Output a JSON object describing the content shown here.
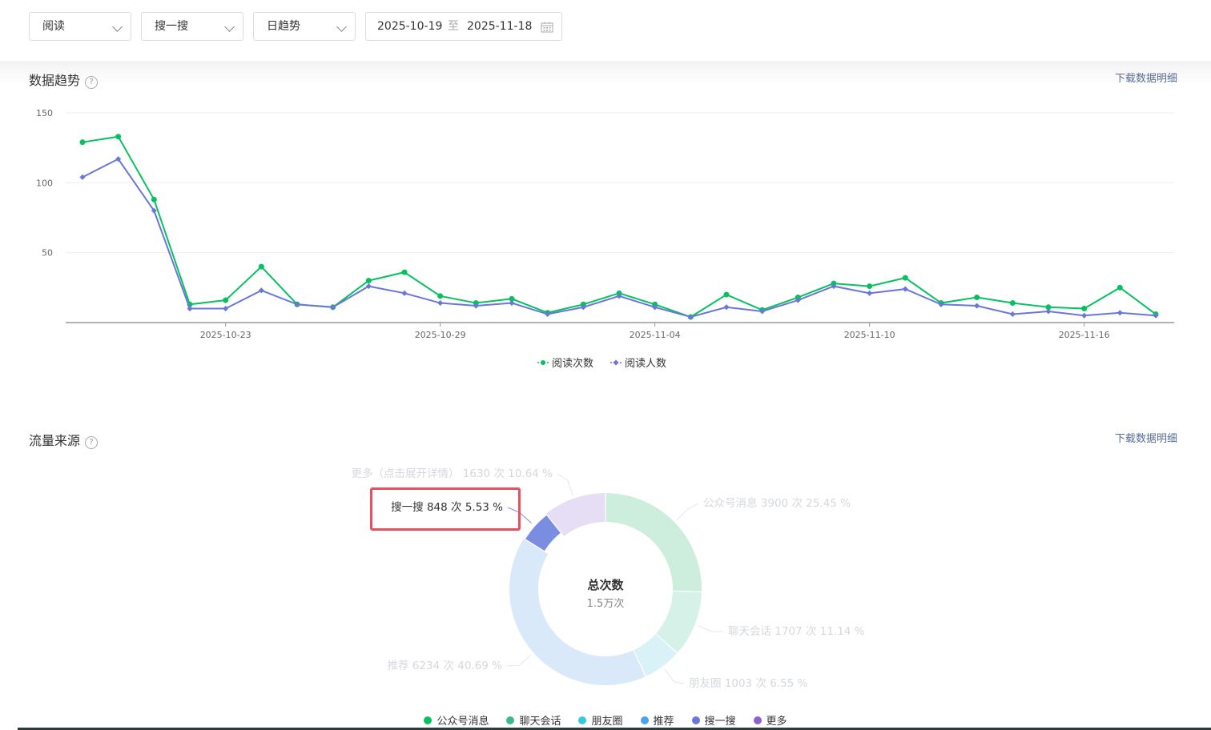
{
  "filters": {
    "metric": "阅读",
    "source": "搜一搜",
    "granularity": "日趋势",
    "date_start": "2025-10-19",
    "date_sep": "至",
    "date_end": "2025-11-18"
  },
  "trend": {
    "title": "数据趋势",
    "help": "?",
    "download": "下载数据明细"
  },
  "source_section": {
    "title": "流量来源",
    "help": "?",
    "download": "下载数据明细",
    "center_title": "总次数",
    "center_value": "1.5万次",
    "slices": [
      {
        "name": "公众号消息",
        "label": "公众号消息 3900 次 25.45 %",
        "value": 3900,
        "color": "#cdeedd"
      },
      {
        "name": "聊天会话",
        "label": "聊天会话 1707 次 11.14 %",
        "value": 1707,
        "color": "#d6f1e8"
      },
      {
        "name": "朋友圈",
        "label": "朋友圈 1003 次 6.55 %",
        "value": 1003,
        "color": "#d9f2f8"
      },
      {
        "name": "推荐",
        "label": "推荐 6234 次 40.69 %",
        "value": 6234,
        "color": "#d9e9f9"
      },
      {
        "name": "搜一搜",
        "label": "搜一搜 848 次 5.53 %",
        "value": 848,
        "color": "#7b8de0"
      },
      {
        "name": "更多",
        "label": "更多（点击展开详情） 1630 次 10.64 %",
        "value": 1630,
        "color": "#e6def4"
      }
    ],
    "legend_colors": [
      "#07c160",
      "#3cb98c",
      "#35c9e0",
      "#4aa3ef",
      "#6a77d8",
      "#8d5fd3"
    ]
  },
  "chart_data": {
    "type": "line",
    "x": [
      "2025-10-19",
      "2025-10-20",
      "2025-10-21",
      "2025-10-22",
      "2025-10-23",
      "2025-10-24",
      "2025-10-25",
      "2025-10-26",
      "2025-10-27",
      "2025-10-28",
      "2025-10-29",
      "2025-10-30",
      "2025-10-31",
      "2025-11-01",
      "2025-11-02",
      "2025-11-03",
      "2025-11-04",
      "2025-11-05",
      "2025-11-06",
      "2025-11-07",
      "2025-11-08",
      "2025-11-09",
      "2025-11-10",
      "2025-11-11",
      "2025-11-12",
      "2025-11-13",
      "2025-11-14",
      "2025-11-15",
      "2025-11-16",
      "2025-11-17",
      "2025-11-18"
    ],
    "x_ticks": [
      "2025-10-23",
      "2025-10-29",
      "2025-11-04",
      "2025-11-10",
      "2025-11-16"
    ],
    "y_ticks": [
      50,
      100,
      150
    ],
    "ylim": [
      0,
      150
    ],
    "series": [
      {
        "name": "阅读次数",
        "color": "#07c160",
        "values": [
          129,
          133,
          88,
          13,
          16,
          40,
          13,
          11,
          30,
          36,
          19,
          14,
          17,
          7,
          13,
          21,
          13,
          4,
          20,
          9,
          18,
          28,
          26,
          32,
          14,
          18,
          14,
          11,
          10,
          25,
          6
        ]
      },
      {
        "name": "阅读人数",
        "color": "#6a77d8",
        "values": [
          104,
          117,
          80,
          10,
          10,
          23,
          13,
          11,
          26,
          21,
          14,
          12,
          14,
          6,
          11,
          19,
          11,
          4,
          11,
          8,
          16,
          26,
          21,
          24,
          13,
          12,
          6,
          8,
          5,
          7,
          5
        ]
      }
    ]
  }
}
